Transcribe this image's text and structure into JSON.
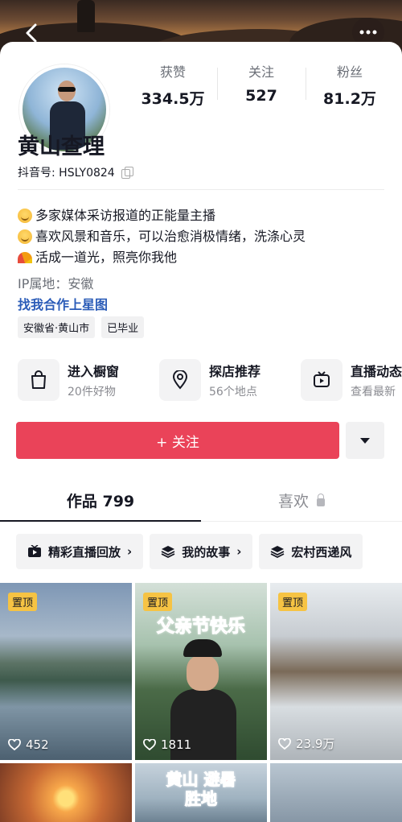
{
  "profile": {
    "name": "黄山查理",
    "uid_label": "抖音号: HSLY0824",
    "stats": [
      {
        "label": "获赞",
        "value": "334.5万"
      },
      {
        "label": "关注",
        "value": "527"
      },
      {
        "label": "粉丝",
        "value": "81.2万"
      }
    ],
    "bio": [
      {
        "emoji": "smile",
        "text": "多家媒体采访报道的正能量主播"
      },
      {
        "emoji": "smile",
        "text": "喜欢风景和音乐，可以治愈消极情绪，洗涤心灵"
      },
      {
        "emoji": "rainbow",
        "text": "活成一道光，照亮你我他"
      }
    ],
    "ip": "IP属地：安徽",
    "link": "找我合作上星图",
    "tags": [
      "安徽省·黄山市",
      "已毕业"
    ]
  },
  "services": [
    {
      "icon": "shopping-bag-icon",
      "title": "进入橱窗",
      "sub": "20件好物"
    },
    {
      "icon": "location-pin-icon",
      "title": "探店推荐",
      "sub": "56个地点"
    },
    {
      "icon": "tv-icon",
      "title": "直播动态",
      "sub": "查看最新"
    }
  ],
  "follow_button": "+ 关注",
  "tabs": [
    {
      "label": "作品 799",
      "active": true
    },
    {
      "label": "喜欢",
      "active": false
    }
  ],
  "collections": [
    {
      "icon": "live-playback-icon",
      "label": "精彩直播回放"
    },
    {
      "icon": "stack-icon",
      "label": "我的故事"
    },
    {
      "icon": "stack-icon",
      "label": "宏村西递风"
    }
  ],
  "videos": [
    {
      "pinned": "置顶",
      "likes": "452"
    },
    {
      "pinned": "置顶",
      "likes": "1811",
      "overlay": "父亲节快乐"
    },
    {
      "pinned": "置顶",
      "likes": "23.9万"
    },
    {
      "overlay": "黄山 避暑胜地"
    }
  ]
}
